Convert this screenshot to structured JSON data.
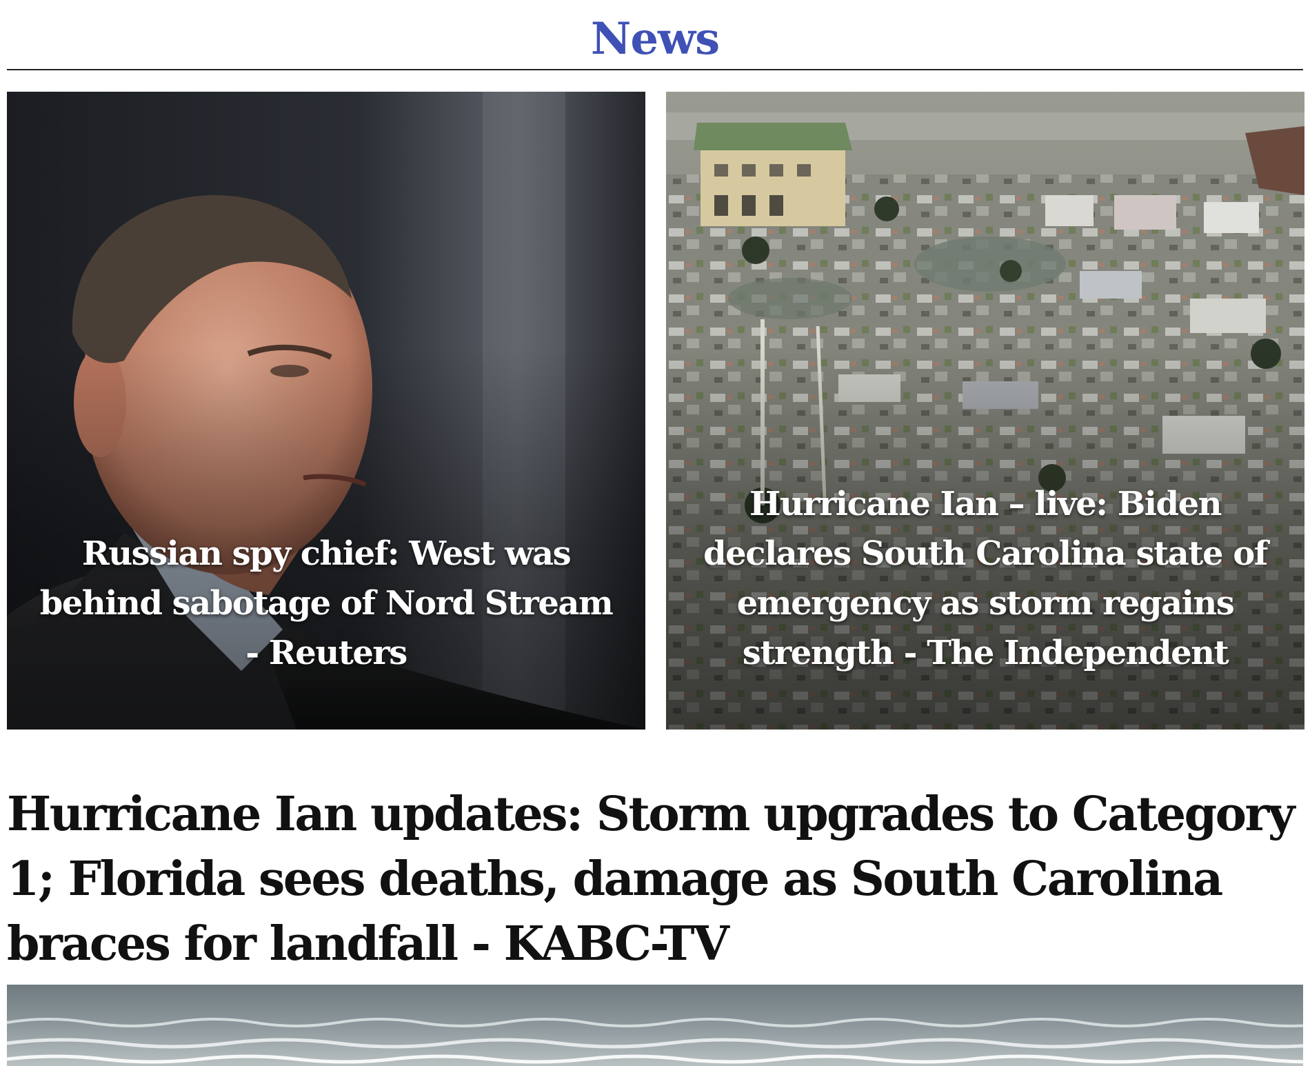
{
  "header": {
    "title": "News",
    "title_color": "#3f51b5"
  },
  "cards": [
    {
      "headline": "Russian spy chief: West was behind sabotage of Nord Stream - Reuters",
      "image": "portrait-photo"
    },
    {
      "headline": "Hurricane Ian – live: Biden declares South Carolina state of emergency as storm regains strength - The Independent",
      "image": "aerial-hurricane-damage-photo"
    }
  ],
  "feature": {
    "headline": "Hurricane Ian updates: Storm upgrades to Category 1; Florida sees deaths, damage as South Carolina braces for landfall - KABC-TV",
    "image": "ocean-waves-photo"
  }
}
